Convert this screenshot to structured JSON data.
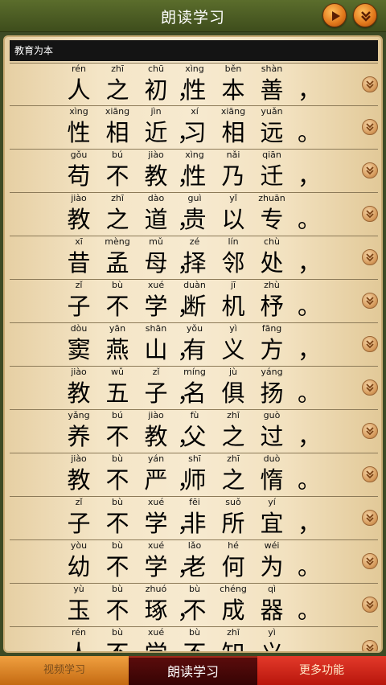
{
  "header": {
    "title": "朗读学习"
  },
  "section": {
    "title": "教育为本"
  },
  "lines": [
    {
      "left": [
        [
          "rén",
          "人"
        ],
        [
          "zhī",
          "之"
        ],
        [
          "chū",
          "初"
        ]
      ],
      "mid": "，",
      "right": [
        [
          "xìng",
          "性"
        ],
        [
          "běn",
          "本"
        ],
        [
          "shàn",
          "善"
        ]
      ],
      "end": "，"
    },
    {
      "left": [
        [
          "xìng",
          "性"
        ],
        [
          "xiāng",
          "相"
        ],
        [
          "jìn",
          "近"
        ]
      ],
      "mid": "，",
      "right": [
        [
          "xí",
          "习"
        ],
        [
          "xiāng",
          "相"
        ],
        [
          "yuǎn",
          "远"
        ]
      ],
      "end": "。"
    },
    {
      "left": [
        [
          "gǒu",
          "苟"
        ],
        [
          "bú",
          "不"
        ],
        [
          "jiào",
          "教"
        ]
      ],
      "mid": "，",
      "right": [
        [
          "xìng",
          "性"
        ],
        [
          "nǎi",
          "乃"
        ],
        [
          "qiān",
          "迁"
        ]
      ],
      "end": "，"
    },
    {
      "left": [
        [
          "jiào",
          "教"
        ],
        [
          "zhī",
          "之"
        ],
        [
          "dào",
          "道"
        ]
      ],
      "mid": "，",
      "right": [
        [
          "guì",
          "贵"
        ],
        [
          "yǐ",
          "以"
        ],
        [
          "zhuān",
          "专"
        ]
      ],
      "end": "。"
    },
    {
      "left": [
        [
          "xī",
          "昔"
        ],
        [
          "mèng",
          "孟"
        ],
        [
          "mǔ",
          "母"
        ]
      ],
      "mid": "，",
      "right": [
        [
          "zé",
          "择"
        ],
        [
          "lín",
          "邻"
        ],
        [
          "chù",
          "处"
        ]
      ],
      "end": "，"
    },
    {
      "left": [
        [
          "zǐ",
          "子"
        ],
        [
          "bù",
          "不"
        ],
        [
          "xué",
          "学"
        ]
      ],
      "mid": "，",
      "right": [
        [
          "duàn",
          "断"
        ],
        [
          "jī",
          "机"
        ],
        [
          "zhù",
          "杼"
        ]
      ],
      "end": "。"
    },
    {
      "left": [
        [
          "dòu",
          "窦"
        ],
        [
          "yān",
          "燕"
        ],
        [
          "shān",
          "山"
        ]
      ],
      "mid": "，",
      "right": [
        [
          "yǒu",
          "有"
        ],
        [
          "yì",
          "义"
        ],
        [
          "fāng",
          "方"
        ]
      ],
      "end": "，"
    },
    {
      "left": [
        [
          "jiào",
          "教"
        ],
        [
          "wǔ",
          "五"
        ],
        [
          "zǐ",
          "子"
        ]
      ],
      "mid": "，",
      "right": [
        [
          "míng",
          "名"
        ],
        [
          "jù",
          "俱"
        ],
        [
          "yáng",
          "扬"
        ]
      ],
      "end": "。"
    },
    {
      "left": [
        [
          "yǎng",
          "养"
        ],
        [
          "bú",
          "不"
        ],
        [
          "jiào",
          "教"
        ]
      ],
      "mid": "，",
      "right": [
        [
          "fù",
          "父"
        ],
        [
          "zhī",
          "之"
        ],
        [
          "guò",
          "过"
        ]
      ],
      "end": "，"
    },
    {
      "left": [
        [
          "jiào",
          "教"
        ],
        [
          "bù",
          "不"
        ],
        [
          "yán",
          "严"
        ]
      ],
      "mid": "，",
      "right": [
        [
          "shī",
          "师"
        ],
        [
          "zhī",
          "之"
        ],
        [
          "duò",
          "惰"
        ]
      ],
      "end": "。"
    },
    {
      "left": [
        [
          "zǐ",
          "子"
        ],
        [
          "bù",
          "不"
        ],
        [
          "xué",
          "学"
        ]
      ],
      "mid": "，",
      "right": [
        [
          "fēi",
          "非"
        ],
        [
          "suǒ",
          "所"
        ],
        [
          "yí",
          "宜"
        ]
      ],
      "end": "，"
    },
    {
      "left": [
        [
          "yòu",
          "幼"
        ],
        [
          "bù",
          "不"
        ],
        [
          "xué",
          "学"
        ]
      ],
      "mid": "，",
      "right": [
        [
          "lǎo",
          "老"
        ],
        [
          "hé",
          "何"
        ],
        [
          "wéi",
          "为"
        ]
      ],
      "end": "。"
    },
    {
      "left": [
        [
          "yù",
          "玉"
        ],
        [
          "bù",
          "不"
        ],
        [
          "zhuó",
          "琢"
        ]
      ],
      "mid": "，",
      "right": [
        [
          "bù",
          "不"
        ],
        [
          "chéng",
          "成"
        ],
        [
          "qì",
          "器"
        ]
      ],
      "end": "。"
    },
    {
      "left": [
        [
          "rén",
          "人"
        ],
        [
          "bù",
          "不"
        ],
        [
          "xué",
          "学"
        ]
      ],
      "mid": "，",
      "right": [
        [
          "bù",
          "不"
        ],
        [
          "zhī",
          "知"
        ],
        [
          "yì",
          "义"
        ]
      ],
      "end": "。"
    }
  ],
  "tabs": {
    "video": "视频学习",
    "read": "朗读学习",
    "more": "更多功能"
  },
  "colors": {
    "accent": "#e0761a",
    "header_bg": "#4a5a22",
    "active_tab": "#4a0808"
  },
  "icons": {
    "play": "play-icon",
    "download": "download-icon"
  }
}
